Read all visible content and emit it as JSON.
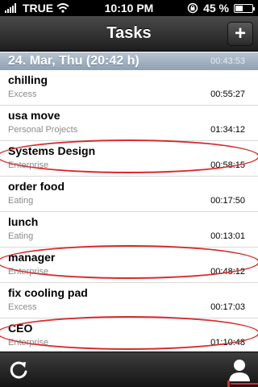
{
  "status_bar": {
    "carrier": "TRUE",
    "time": "10:10 PM",
    "battery_text": "45 %",
    "battery_level": 0.45
  },
  "nav": {
    "title": "Tasks",
    "add_label": "+"
  },
  "section": {
    "header": "24. Mar, Thu (20:42 h)",
    "header_time": "00:43:53"
  },
  "tasks": [
    {
      "title": "chilling",
      "category": "Excess",
      "time": "00:55:27"
    },
    {
      "title": "usa move",
      "category": "Personal Projects",
      "time": "01:34:12"
    },
    {
      "title": "Systems Design",
      "category": "Enterprise",
      "time": "00:58:15"
    },
    {
      "title": "order food",
      "category": "Eating",
      "time": "00:17:50"
    },
    {
      "title": "lunch",
      "category": "Eating",
      "time": "00:13:01"
    },
    {
      "title": "manager",
      "category": "Enterprise",
      "time": "00:48:12"
    },
    {
      "title": "fix cooling pad",
      "category": "Excess",
      "time": "00:17:03"
    },
    {
      "title": "CEO",
      "category": "Enterprise",
      "time": "01:10:48"
    }
  ],
  "colors": {
    "annotation_circle": "#d92b2b",
    "section_header": "#8fa1b3"
  },
  "icons": {
    "refresh": "refresh-icon",
    "profile": "profile-icon",
    "wifi": "wifi-icon",
    "signal": "signal-icon",
    "lock": "rotation-lock-icon"
  }
}
